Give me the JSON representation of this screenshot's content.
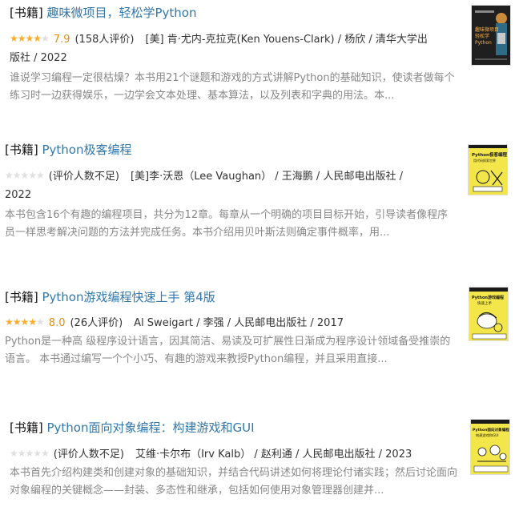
{
  "results": [
    {
      "category": "[书籍]",
      "title": "趣味微项目，轻松学Python",
      "stars": "★★★★☆",
      "stars_filled": 4,
      "rating": "7.9",
      "count": "(158人评价)",
      "pub_line1": "[美] 肯·尤内-克拉克(Ken Youens-Clark) / 杨欣 / 清华大学出",
      "pub_line2": "版社 / 2022",
      "abstract": "谁说学习编程一定很枯燥？本书用21个谜题和游戏的方式讲解Python的基础知识，使读者做每个练习时一边获得娱乐，一边学会文本处理、基本算法，以及列表和字典的用法。本...",
      "cover": {
        "bg": "#1f1f1f",
        "accent": "#c98a3b",
        "text_cn": "趣味微项目",
        "text_cn2": "轻松学",
        "text_en": "Python"
      }
    },
    {
      "category": "[书籍]",
      "title": "Python极客编程",
      "stars": "☆☆☆☆☆",
      "stars_filled": 0,
      "rating": "",
      "count": "(评价人数不足)",
      "pub_line1": "[美]李·沃恩（Lee Vaughan） / 王海鹏 / 人民邮电出版社 /",
      "pub_line2": "2022",
      "abstract": "本书包含16个有趣的编程项目，共分为12章。每章从一个明确的项目目标开始，引导读者像程序员一样思考解决问题的方法并完成任务。本书介绍用贝叶斯法则确定事件概率，用...",
      "cover": {
        "bg": "#f3e64a",
        "accent": "#1a1a1a",
        "text_cn": "Python极客编程",
        "text_cn2": "用代码探索世界",
        "text_en": ""
      }
    },
    {
      "category": "[书籍]",
      "title": "Python游戏编程快速上手 第4版",
      "stars": "★★★★☆",
      "stars_filled": 4,
      "rating": "8.0",
      "count": "(26人评价)",
      "pub_line1": "Al Sweigart / 李强 / 人民邮电出版社 / 2017",
      "pub_line2": "",
      "abstract": "Python是一种高 级程序设计语言，因其简洁、易读及可扩展性日渐成为程序设计领域备受推崇的语言。 本书通过编写一个个小巧、有趣的游戏来教授Python编程，并且采用直接...",
      "cover": {
        "bg": "#f3e64a",
        "accent": "#1a1a1a",
        "text_cn": "Python游戏编程",
        "text_cn2": "快速上手",
        "text_en": ""
      }
    },
    {
      "category": "[书籍]",
      "title": "Python面向对象编程：构建游戏和GUI",
      "stars": "☆☆☆☆☆",
      "stars_filled": 0,
      "rating": "",
      "count": "(评价人数不足)",
      "pub_line1": "艾维·卡尔布（Irv Kalb） / 赵利通 / 人民邮电出版社 / 2023",
      "pub_line2": "",
      "abstract": "本书首先介绍构建类和创建对象的基础知识，并结合代码讲述如何将理论付诸实践；然后讨论面向对象编程的关键概念——封装、多态性和继承，包括如何使用对象管理器创建并...",
      "cover": {
        "bg": "#f3e64a",
        "accent": "#1a1a1a",
        "text_cn": "Python面向对象编程",
        "text_cn2": "构建游戏和GUI",
        "text_en": ""
      }
    }
  ]
}
